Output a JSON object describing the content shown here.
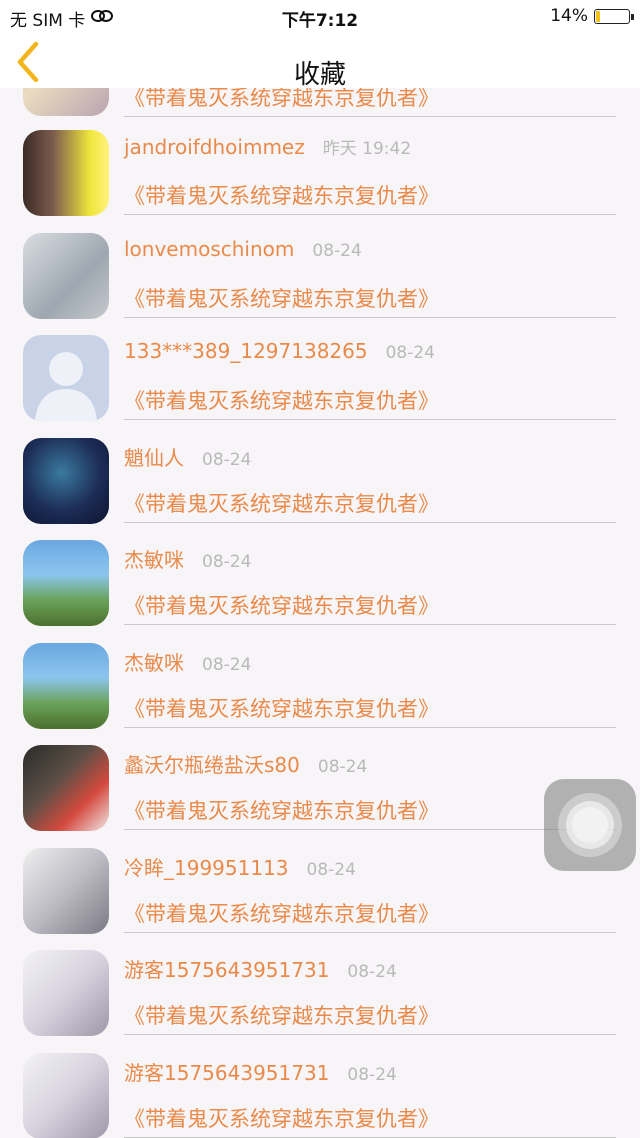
{
  "status_bar": {
    "carrier": "无 SIM 卡",
    "time": "下午7:12",
    "battery": "14%",
    "battery_level": 0.14
  },
  "nav": {
    "title": "收藏",
    "accent_color": "#f3b51c"
  },
  "colors": {
    "name": "#ea8a4a",
    "date": "#b9b9b9"
  },
  "partial_row": {
    "book": "《带着鬼灭系统穿越东京复仇者》"
  },
  "rows": [
    {
      "name": "jandroifdhoimmez",
      "date": "昨天 19:42",
      "book": "《带着鬼灭系统穿越东京复仇者》"
    },
    {
      "name": "lonvemoschinom",
      "date": "08-24",
      "book": "《带着鬼灭系统穿越东京复仇者》"
    },
    {
      "name": "133***389_1297138265",
      "date": "08-24",
      "book": "《带着鬼灭系统穿越东京复仇者》"
    },
    {
      "name": "魈仙人",
      "date": "08-24",
      "book": "《带着鬼灭系统穿越东京复仇者》"
    },
    {
      "name": "杰敏咪",
      "date": "08-24",
      "book": "《带着鬼灭系统穿越东京复仇者》"
    },
    {
      "name": "杰敏咪",
      "date": "08-24",
      "book": "《带着鬼灭系统穿越东京复仇者》"
    },
    {
      "name": "蠡沃尔瓶绻盐沃s80",
      "date": "08-24",
      "book": "《带着鬼灭系统穿越东京复仇者》"
    },
    {
      "name": "冷眸_199951113",
      "date": "08-24",
      "book": "《带着鬼灭系统穿越东京复仇者》"
    },
    {
      "name": "游客1575643951731",
      "date": "08-24",
      "book": "《带着鬼灭系统穿越东京复仇者》"
    },
    {
      "name": "游客1575643951731",
      "date": "08-24",
      "book": "《带着鬼灭系统穿越东京复仇者》"
    }
  ]
}
